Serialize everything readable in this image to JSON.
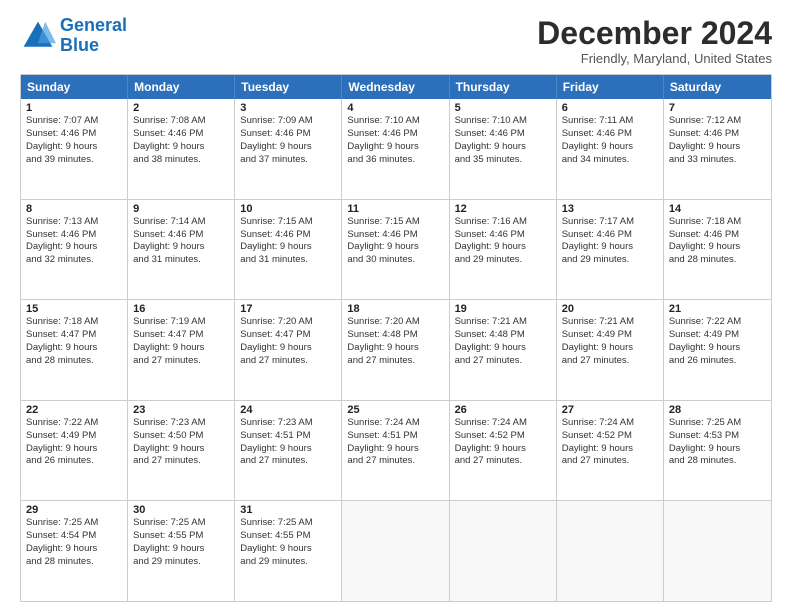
{
  "logo": {
    "line1": "General",
    "line2": "Blue"
  },
  "title": "December 2024",
  "location": "Friendly, Maryland, United States",
  "header_days": [
    "Sunday",
    "Monday",
    "Tuesday",
    "Wednesday",
    "Thursday",
    "Friday",
    "Saturday"
  ],
  "rows": [
    [
      {
        "day": "1",
        "lines": [
          "Sunrise: 7:07 AM",
          "Sunset: 4:46 PM",
          "Daylight: 9 hours",
          "and 39 minutes."
        ]
      },
      {
        "day": "2",
        "lines": [
          "Sunrise: 7:08 AM",
          "Sunset: 4:46 PM",
          "Daylight: 9 hours",
          "and 38 minutes."
        ]
      },
      {
        "day": "3",
        "lines": [
          "Sunrise: 7:09 AM",
          "Sunset: 4:46 PM",
          "Daylight: 9 hours",
          "and 37 minutes."
        ]
      },
      {
        "day": "4",
        "lines": [
          "Sunrise: 7:10 AM",
          "Sunset: 4:46 PM",
          "Daylight: 9 hours",
          "and 36 minutes."
        ]
      },
      {
        "day": "5",
        "lines": [
          "Sunrise: 7:10 AM",
          "Sunset: 4:46 PM",
          "Daylight: 9 hours",
          "and 35 minutes."
        ]
      },
      {
        "day": "6",
        "lines": [
          "Sunrise: 7:11 AM",
          "Sunset: 4:46 PM",
          "Daylight: 9 hours",
          "and 34 minutes."
        ]
      },
      {
        "day": "7",
        "lines": [
          "Sunrise: 7:12 AM",
          "Sunset: 4:46 PM",
          "Daylight: 9 hours",
          "and 33 minutes."
        ]
      }
    ],
    [
      {
        "day": "8",
        "lines": [
          "Sunrise: 7:13 AM",
          "Sunset: 4:46 PM",
          "Daylight: 9 hours",
          "and 32 minutes."
        ]
      },
      {
        "day": "9",
        "lines": [
          "Sunrise: 7:14 AM",
          "Sunset: 4:46 PM",
          "Daylight: 9 hours",
          "and 31 minutes."
        ]
      },
      {
        "day": "10",
        "lines": [
          "Sunrise: 7:15 AM",
          "Sunset: 4:46 PM",
          "Daylight: 9 hours",
          "and 31 minutes."
        ]
      },
      {
        "day": "11",
        "lines": [
          "Sunrise: 7:15 AM",
          "Sunset: 4:46 PM",
          "Daylight: 9 hours",
          "and 30 minutes."
        ]
      },
      {
        "day": "12",
        "lines": [
          "Sunrise: 7:16 AM",
          "Sunset: 4:46 PM",
          "Daylight: 9 hours",
          "and 29 minutes."
        ]
      },
      {
        "day": "13",
        "lines": [
          "Sunrise: 7:17 AM",
          "Sunset: 4:46 PM",
          "Daylight: 9 hours",
          "and 29 minutes."
        ]
      },
      {
        "day": "14",
        "lines": [
          "Sunrise: 7:18 AM",
          "Sunset: 4:46 PM",
          "Daylight: 9 hours",
          "and 28 minutes."
        ]
      }
    ],
    [
      {
        "day": "15",
        "lines": [
          "Sunrise: 7:18 AM",
          "Sunset: 4:47 PM",
          "Daylight: 9 hours",
          "and 28 minutes."
        ]
      },
      {
        "day": "16",
        "lines": [
          "Sunrise: 7:19 AM",
          "Sunset: 4:47 PM",
          "Daylight: 9 hours",
          "and 27 minutes."
        ]
      },
      {
        "day": "17",
        "lines": [
          "Sunrise: 7:20 AM",
          "Sunset: 4:47 PM",
          "Daylight: 9 hours",
          "and 27 minutes."
        ]
      },
      {
        "day": "18",
        "lines": [
          "Sunrise: 7:20 AM",
          "Sunset: 4:48 PM",
          "Daylight: 9 hours",
          "and 27 minutes."
        ]
      },
      {
        "day": "19",
        "lines": [
          "Sunrise: 7:21 AM",
          "Sunset: 4:48 PM",
          "Daylight: 9 hours",
          "and 27 minutes."
        ]
      },
      {
        "day": "20",
        "lines": [
          "Sunrise: 7:21 AM",
          "Sunset: 4:49 PM",
          "Daylight: 9 hours",
          "and 27 minutes."
        ]
      },
      {
        "day": "21",
        "lines": [
          "Sunrise: 7:22 AM",
          "Sunset: 4:49 PM",
          "Daylight: 9 hours",
          "and 26 minutes."
        ]
      }
    ],
    [
      {
        "day": "22",
        "lines": [
          "Sunrise: 7:22 AM",
          "Sunset: 4:49 PM",
          "Daylight: 9 hours",
          "and 26 minutes."
        ]
      },
      {
        "day": "23",
        "lines": [
          "Sunrise: 7:23 AM",
          "Sunset: 4:50 PM",
          "Daylight: 9 hours",
          "and 27 minutes."
        ]
      },
      {
        "day": "24",
        "lines": [
          "Sunrise: 7:23 AM",
          "Sunset: 4:51 PM",
          "Daylight: 9 hours",
          "and 27 minutes."
        ]
      },
      {
        "day": "25",
        "lines": [
          "Sunrise: 7:24 AM",
          "Sunset: 4:51 PM",
          "Daylight: 9 hours",
          "and 27 minutes."
        ]
      },
      {
        "day": "26",
        "lines": [
          "Sunrise: 7:24 AM",
          "Sunset: 4:52 PM",
          "Daylight: 9 hours",
          "and 27 minutes."
        ]
      },
      {
        "day": "27",
        "lines": [
          "Sunrise: 7:24 AM",
          "Sunset: 4:52 PM",
          "Daylight: 9 hours",
          "and 27 minutes."
        ]
      },
      {
        "day": "28",
        "lines": [
          "Sunrise: 7:25 AM",
          "Sunset: 4:53 PM",
          "Daylight: 9 hours",
          "and 28 minutes."
        ]
      }
    ],
    [
      {
        "day": "29",
        "lines": [
          "Sunrise: 7:25 AM",
          "Sunset: 4:54 PM",
          "Daylight: 9 hours",
          "and 28 minutes."
        ]
      },
      {
        "day": "30",
        "lines": [
          "Sunrise: 7:25 AM",
          "Sunset: 4:55 PM",
          "Daylight: 9 hours",
          "and 29 minutes."
        ]
      },
      {
        "day": "31",
        "lines": [
          "Sunrise: 7:25 AM",
          "Sunset: 4:55 PM",
          "Daylight: 9 hours",
          "and 29 minutes."
        ]
      },
      null,
      null,
      null,
      null
    ]
  ]
}
